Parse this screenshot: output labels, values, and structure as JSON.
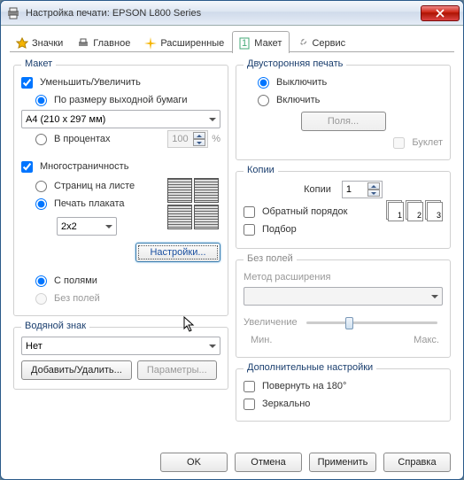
{
  "window": {
    "title": "Настройка печати: EPSON L800 Series"
  },
  "tabs": {
    "icons": "Значки",
    "main": "Главное",
    "advanced": "Расширенные",
    "layout": "Макет",
    "service": "Сервис"
  },
  "layout": {
    "legend": "Макет",
    "reduce_enlarge": "Уменьшить/Увеличить",
    "by_paper": "По размеру выходной бумаги",
    "paper_size": "A4 (210 x 297 мм)",
    "by_percent": "В процентах",
    "percent_value": "100",
    "percent_sign": "%",
    "multipage": "Многостраничность",
    "pages_per_sheet": "Страниц на листе",
    "poster": "Печать плаката",
    "poster_size": "2x2",
    "settings_btn": "Настройки...",
    "with_borders": "С полями",
    "without_borders": "Без полей"
  },
  "watermark": {
    "legend": "Водяной знак",
    "value": "Нет",
    "add_remove": "Добавить/Удалить...",
    "params": "Параметры..."
  },
  "duplex": {
    "legend": "Двусторонняя печать",
    "off": "Выключить",
    "on": "Включить",
    "margins_btn": "Поля...",
    "booklet": "Буклет"
  },
  "copies": {
    "legend": "Копии",
    "label": "Копии",
    "value": "1",
    "reverse": "Обратный порядок",
    "collate": "Подбор"
  },
  "borderless": {
    "legend": "Без полей",
    "method": "Метод расширения",
    "enlarge": "Увеличение",
    "min": "Мин.",
    "max": "Макс."
  },
  "more": {
    "legend": "Дополнительные настройки",
    "rotate": "Повернуть на 180°",
    "mirror": "Зеркально"
  },
  "footer": {
    "ok": "OK",
    "cancel": "Отмена",
    "apply": "Применить",
    "help": "Справка"
  }
}
